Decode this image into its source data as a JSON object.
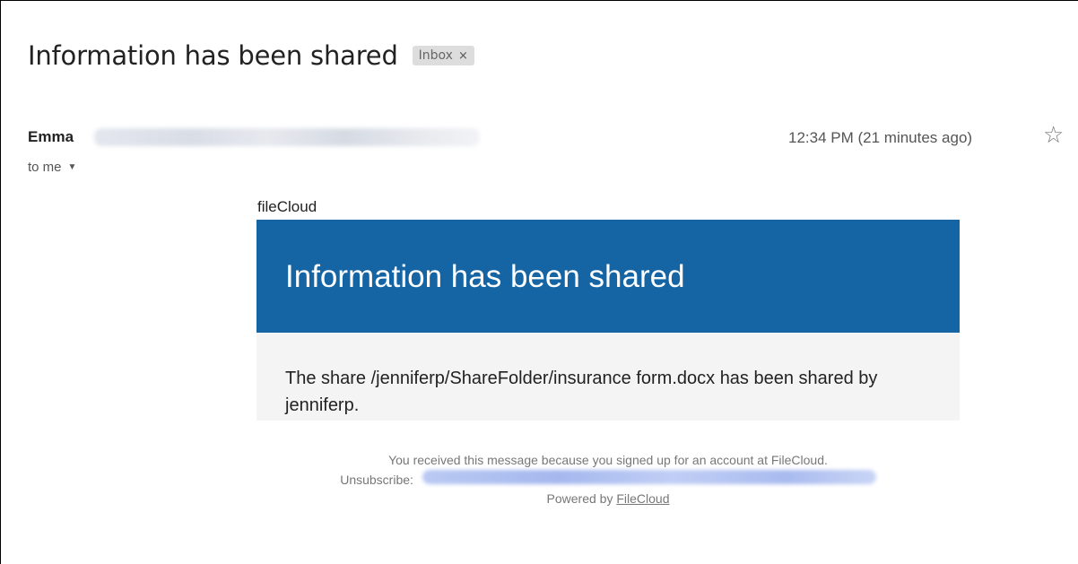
{
  "email": {
    "subject": "Information has been shared",
    "label": "Inbox",
    "label_remove": "×",
    "sender_name": "Emma",
    "timestamp": "12:34 PM (21 minutes ago)",
    "recipient_text": "to me",
    "star_icon": "☆",
    "caret_icon": "▼"
  },
  "message": {
    "brand": "fileCloud",
    "banner_title": "Information has been shared",
    "body": "The share /jenniferp/ShareFolder/insurance form.docx has been shared by jenniferp."
  },
  "footer": {
    "reason": "You received this message because you signed up for an account at FileCloud.",
    "unsubscribe_label": "Unsubscribe:",
    "powered_prefix": "Powered by ",
    "powered_link": "FileCloud"
  },
  "colors": {
    "banner": "#1565a4",
    "body_bg": "#f4f4f4",
    "chip_bg": "#dddddd"
  }
}
